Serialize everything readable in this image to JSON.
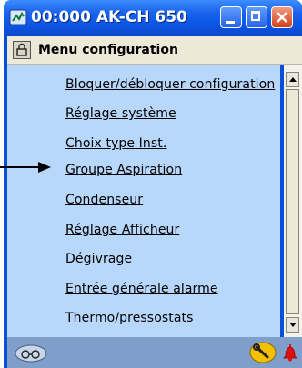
{
  "window": {
    "title": "00:000 AK-CH 650"
  },
  "subheader": {
    "title": "Menu configuration"
  },
  "menu": {
    "items": [
      {
        "label": "Bloquer/débloquer configuration"
      },
      {
        "label": "Réglage système"
      },
      {
        "label": "Choix type Inst."
      },
      {
        "label": "Groupe Aspiration"
      },
      {
        "label": "Condenseur"
      },
      {
        "label": "Réglage Afficheur"
      },
      {
        "label": "Dégivrage"
      },
      {
        "label": "Entrée générale alarme"
      },
      {
        "label": "Thermo/pressostats"
      }
    ]
  },
  "colors": {
    "titlebar": "#0c55e3",
    "content_background": "#b7d7fb",
    "statusbar": "#7f9ec9",
    "subheader": "#ece9d8"
  },
  "icons": {
    "title": "network-controller-icon",
    "lock": "lock-icon",
    "status_left": "glasses-icon",
    "status_wrench": "wrench-icon",
    "status_alarm": "alarm-bell-icon",
    "pointer": "arrow-right-icon"
  }
}
